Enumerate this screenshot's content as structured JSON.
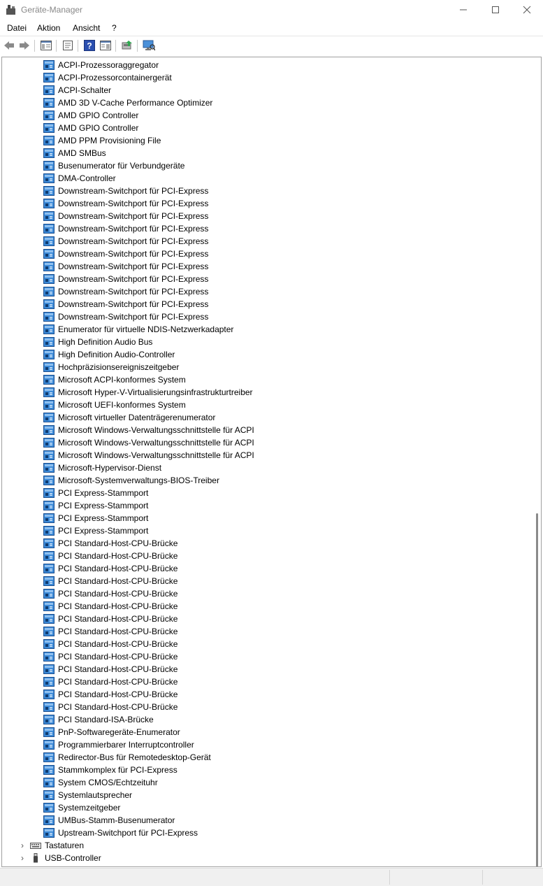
{
  "window": {
    "title": "Geräte-Manager",
    "min_icon": "minimize-icon",
    "max_icon": "maximize-icon",
    "close_icon": "close-icon"
  },
  "menu": [
    "Datei",
    "Aktion",
    "Ansicht",
    "?"
  ],
  "toolbar": [
    "back-icon",
    "forward-icon",
    "show-hide-console-tree-icon",
    "properties-icon",
    "help-icon",
    "view-icon",
    "update-driver-icon",
    "scan-hardware-icon"
  ],
  "system_devices": [
    "ACPI-Prozessoraggregator",
    "ACPI-Prozessorcontainergerät",
    "ACPI-Schalter",
    "AMD 3D V-Cache Performance Optimizer",
    "AMD GPIO Controller",
    "AMD GPIO Controller",
    "AMD PPM Provisioning File",
    "AMD SMBus",
    "Busenumerator für Verbundgeräte",
    "DMA-Controller",
    "Downstream-Switchport für PCI-Express",
    "Downstream-Switchport für PCI-Express",
    "Downstream-Switchport für PCI-Express",
    "Downstream-Switchport für PCI-Express",
    "Downstream-Switchport für PCI-Express",
    "Downstream-Switchport für PCI-Express",
    "Downstream-Switchport für PCI-Express",
    "Downstream-Switchport für PCI-Express",
    "Downstream-Switchport für PCI-Express",
    "Downstream-Switchport für PCI-Express",
    "Downstream-Switchport für PCI-Express",
    "Enumerator für virtuelle NDIS-Netzwerkadapter",
    "High Definition Audio Bus",
    "High Definition Audio-Controller",
    "Hochpräzisionsereigniszeitgeber",
    "Microsoft ACPI-konformes System",
    "Microsoft Hyper-V-Virtualisierungsinfrastrukturtreiber",
    "Microsoft UEFI-konformes System",
    "Microsoft virtueller Datenträgerenumerator",
    "Microsoft Windows-Verwaltungsschnittstelle für ACPI",
    "Microsoft Windows-Verwaltungsschnittstelle für ACPI",
    "Microsoft Windows-Verwaltungsschnittstelle für ACPI",
    "Microsoft-Hypervisor-Dienst",
    "Microsoft-Systemverwaltungs-BIOS-Treiber",
    "PCI Express-Stammport",
    "PCI Express-Stammport",
    "PCI Express-Stammport",
    "PCI Express-Stammport",
    "PCI Standard-Host-CPU-Brücke",
    "PCI Standard-Host-CPU-Brücke",
    "PCI Standard-Host-CPU-Brücke",
    "PCI Standard-Host-CPU-Brücke",
    "PCI Standard-Host-CPU-Brücke",
    "PCI Standard-Host-CPU-Brücke",
    "PCI Standard-Host-CPU-Brücke",
    "PCI Standard-Host-CPU-Brücke",
    "PCI Standard-Host-CPU-Brücke",
    "PCI Standard-Host-CPU-Brücke",
    "PCI Standard-Host-CPU-Brücke",
    "PCI Standard-Host-CPU-Brücke",
    "PCI Standard-Host-CPU-Brücke",
    "PCI Standard-Host-CPU-Brücke",
    "PCI Standard-ISA-Brücke",
    "PnP-Softwaregeräte-Enumerator",
    "Programmierbarer Interruptcontroller",
    "Redirector-Bus für Remotedesktop-Gerät",
    "Stammkomplex für PCI-Express",
    "System CMOS/Echtzeituhr",
    "Systemlautsprecher",
    "Systemzeitgeber",
    "UMBus-Stamm-Busenumerator",
    "Upstream-Switchport für PCI-Express"
  ],
  "categories": [
    {
      "label": "Tastaturen",
      "icon": "keyboard-icon",
      "expander": "›"
    },
    {
      "label": "USB-Controller",
      "icon": "usb-icon",
      "expander": "›"
    }
  ],
  "colors": {
    "device_icon": "#1f6fb5",
    "accent": "#0078d4"
  }
}
